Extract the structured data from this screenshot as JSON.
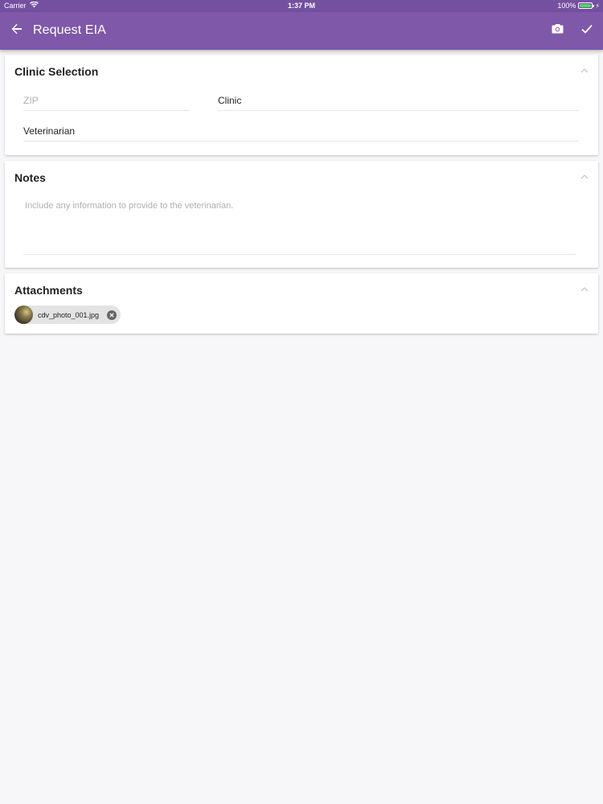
{
  "status_bar": {
    "carrier": "Carrier",
    "time": "1:37 PM",
    "battery": "100%",
    "battery_level": 1.0,
    "battery_color": "#4cd964"
  },
  "app_bar": {
    "title": "Request EIA",
    "color": "#7f58a9",
    "icons": [
      "back-arrow-icon",
      "camera-icon",
      "check-icon"
    ]
  },
  "clinic_selection": {
    "title": "Clinic Selection",
    "zip": {
      "placeholder": "ZIP",
      "value": ""
    },
    "clinic": {
      "value": "Clinic"
    },
    "veterinarian": {
      "value": "Veterinarian"
    }
  },
  "notes": {
    "title": "Notes",
    "placeholder": "Include any information to provide to the veterinarian."
  },
  "attachments": {
    "title": "Attachments",
    "items": [
      {
        "filename": "cdv_photo_001.jpg"
      }
    ]
  }
}
